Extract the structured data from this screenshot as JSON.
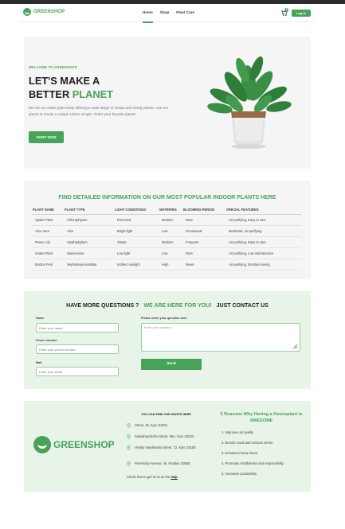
{
  "brand": {
    "name": "GREENSHOP",
    "accent": "#46a358"
  },
  "nav": {
    "items": [
      {
        "label": "Home",
        "active": true
      },
      {
        "label": "Shop",
        "active": false
      },
      {
        "label": "Plant Care",
        "active": false
      }
    ],
    "cart_count": "0",
    "login_label": "Log In"
  },
  "hero": {
    "welcome": "WELCOME TO GREENSHOP",
    "title_line1": "LET'S MAKE A",
    "title_line2_a": "BETTER ",
    "title_line2_b": "PLANET",
    "description": "We are an online plant shop offering a wide range of cheap and trendy plants. Use our plants to create a unique Urban Jungle. Order your favorite plants!",
    "cta": "SHOP NOW"
  },
  "plants_table": {
    "title": "FIND DETAILED INFORMATION ON OUR MOST POPULAR INDOOR PLANTS HERE",
    "headers": [
      "PLANT NAME",
      "PLANT TYPE",
      "LIGHT CONDITIONS",
      "WATERING",
      "BLOOMING PERIOD",
      "SPECIAL FEATURES"
    ],
    "rows": [
      [
        "Spider Plant",
        "Chlorophytum",
        "Perennial",
        "Medium",
        "Rare",
        "Air-purifying, Easy to care"
      ],
      [
        "Aloe Vera",
        "Aloe",
        "Bright light",
        "Low",
        "Occasional",
        "Medicinal, Air-purifying"
      ],
      [
        "Peace Lily",
        "Spathiphyllum",
        "Shade",
        "Medium",
        "Frequent",
        "Air-purifying, Easy to care"
      ],
      [
        "Snake Plant",
        "Sansevieria",
        "Low light",
        "Low",
        "Rare",
        "Air-purifying, Low maintenance"
      ],
      [
        "Boston Fern",
        "Nephrolepis exaltata",
        "Indirect sunlight",
        "High",
        "Never",
        "Air-purifying, Moisture loving"
      ]
    ]
  },
  "contact": {
    "heading_a": "HAVE MORE QUESTIONS ?",
    "heading_b": "WE ARE HERE FOR YOU!",
    "heading_c": "JUST CONTACT US",
    "name_label": "Name",
    "name_placeholder": "Enter your name",
    "phone_label": "Phone number",
    "phone_placeholder": "Enter your phone number",
    "mail_label": "Mail",
    "mail_placeholder": "Enter your email",
    "question_label": "Please enter your question here",
    "question_placeholder": "Enter your question",
    "send_label": "Send"
  },
  "footer": {
    "logo": "GREENSHOP",
    "shops_heading": "YOU CAN FIND OUR SHOPS HERE",
    "addresses": [
      "Street, 15, Kyiv, 01001",
      "Saksahanskoho Street, 35A, Kyiv, 01033",
      "Velyka Vasylkivska Street, 72, Kyiv, 03150",
      "Peremohy Avenue, 45, Kharkiv, 03058"
    ],
    "map_text": "Check how to get to us on the ",
    "map_link": "map",
    "reasons_title": "5 Reasons Why Having a Houseplant is AWESOME",
    "reasons": [
      "1. Improves air quality",
      "2. Boosts mood and reduces stress",
      "3. Enhances home decor",
      "4. Promotes mindfulness and responsibility",
      "5. Increases productivity"
    ]
  }
}
